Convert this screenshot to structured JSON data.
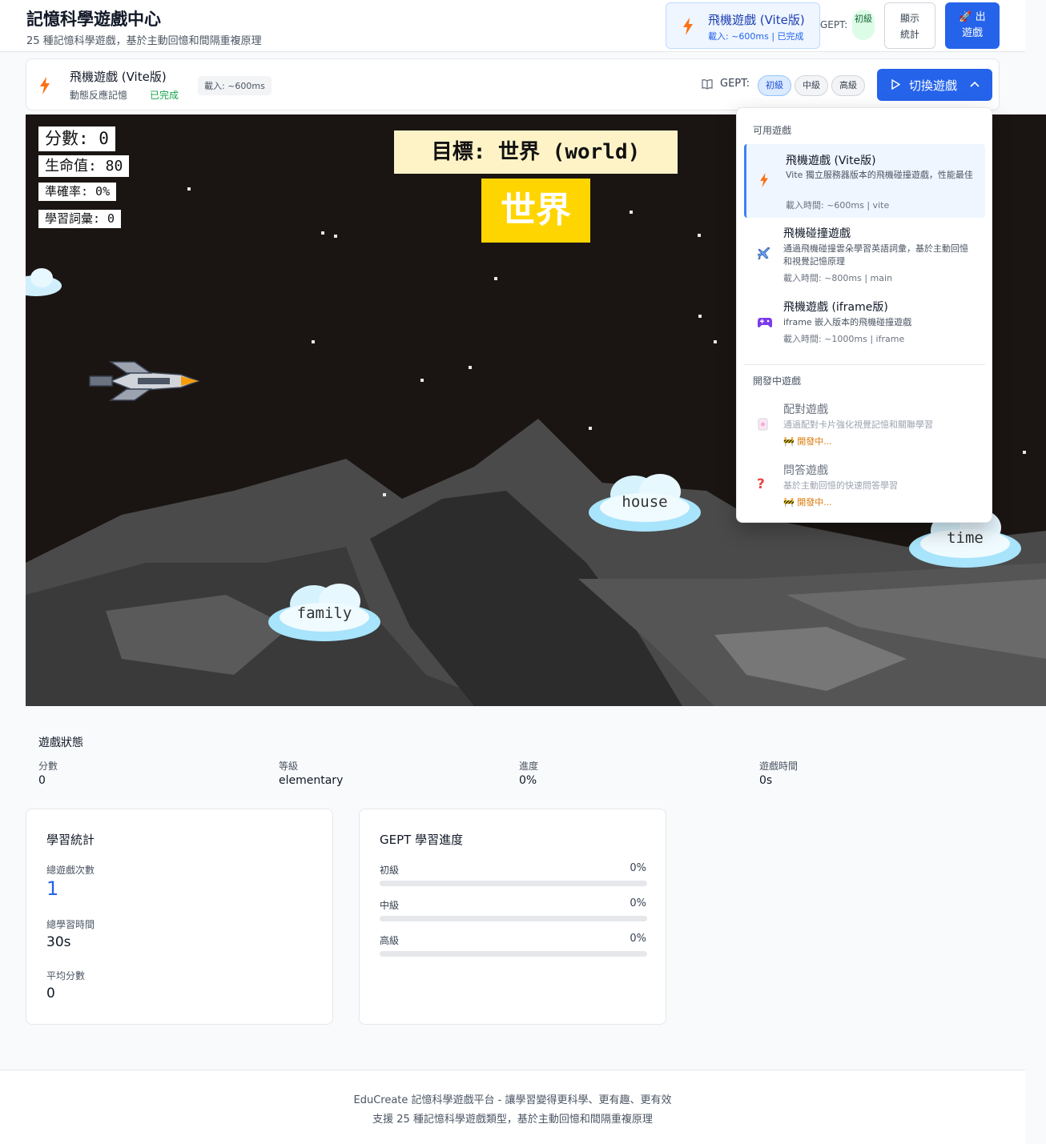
{
  "header": {
    "title": "記憶科學遊戲中心",
    "subtitle": "25 種記憶科學遊戲，基於主動回憶和間隔重複原理",
    "current_game": {
      "name": "飛機遊戲 (Vite版)",
      "meta": "載入: ~600ms | 已完成"
    },
    "gept_label": "GEPT:",
    "gept_level": "初級",
    "stats_button": "顯示統計",
    "exit_button": "🚀 出遊戲"
  },
  "game_bar": {
    "name": "飛機遊戲 (Vite版)",
    "description": "動態反應記憶",
    "status": "已完成",
    "load": "載入: ~600ms",
    "gept_label": "GEPT:",
    "levels": [
      "初級",
      "中級",
      "高級"
    ],
    "active_level": "初級",
    "switch_button": "切換遊戲"
  },
  "game": {
    "hud": {
      "score": "分數: 0",
      "hp": "生命值: 80",
      "accuracy": "準確率: 0%",
      "vocab": "學習詞彙: 0"
    },
    "target": "目標: 世界 (world)",
    "target_cn": "世界",
    "clouds": [
      "house",
      "time",
      "family"
    ]
  },
  "dropdown": {
    "available_title": "可用遊戲",
    "dev_title": "開發中遊戲",
    "available": [
      {
        "name": "飛機遊戲 (Vite版)",
        "desc": "Vite 獨立服務器版本的飛機碰撞遊戲，性能最佳",
        "load": "載入時間: ~600ms | vite",
        "icon": "lightning-icon"
      },
      {
        "name": "飛機碰撞遊戲",
        "desc": "通過飛機碰撞雲朵學習英語詞彙，基於主動回憶和視覺記憶原理",
        "load": "載入時間: ~800ms | main",
        "icon": "airplane-icon"
      },
      {
        "name": "飛機遊戲 (iframe版)",
        "desc": "iframe 嵌入版本的飛機碰撞遊戲",
        "load": "載入時間: ~1000ms | iframe",
        "icon": "gamepad-icon"
      }
    ],
    "dev": [
      {
        "name": "配對遊戲",
        "desc": "通過配對卡片強化視覺記憶和關聯學習",
        "status": "🚧 開發中...",
        "icon": "cards-icon"
      },
      {
        "name": "問答遊戲",
        "desc": "基於主動回憶的快速問答學習",
        "status": "🚧 開發中...",
        "icon": "question-icon"
      }
    ]
  },
  "status": {
    "title": "遊戲狀態",
    "items": [
      {
        "label": "分數",
        "value": "0"
      },
      {
        "label": "等級",
        "value": "elementary"
      },
      {
        "label": "進度",
        "value": "0%"
      },
      {
        "label": "遊戲時間",
        "value": "0s"
      }
    ]
  },
  "learning_stats": {
    "title": "學習統計",
    "total_games_label": "總遊戲次數",
    "total_games": "1",
    "total_time_label": "總學習時間",
    "total_time": "30s",
    "avg_score_label": "平均分數",
    "avg_score": "0"
  },
  "gept_progress": {
    "title": "GEPT 學習進度",
    "levels": [
      {
        "label": "初級",
        "pct": "0%",
        "value": 0
      },
      {
        "label": "中級",
        "pct": "0%",
        "value": 0
      },
      {
        "label": "高級",
        "pct": "0%",
        "value": 0
      }
    ]
  },
  "footer": {
    "line1": "EduCreate 記憶科學遊戲平台 - 讓學習變得更科學、更有趣、更有效",
    "line2": "支援 25 種記憶科學遊戲類型，基於主動回憶和間隔重複原理"
  },
  "colors": {
    "primary": "#2563eb",
    "success": "#16a34a",
    "target_bg": "#ffd500",
    "space_bg": "#1a1513"
  }
}
